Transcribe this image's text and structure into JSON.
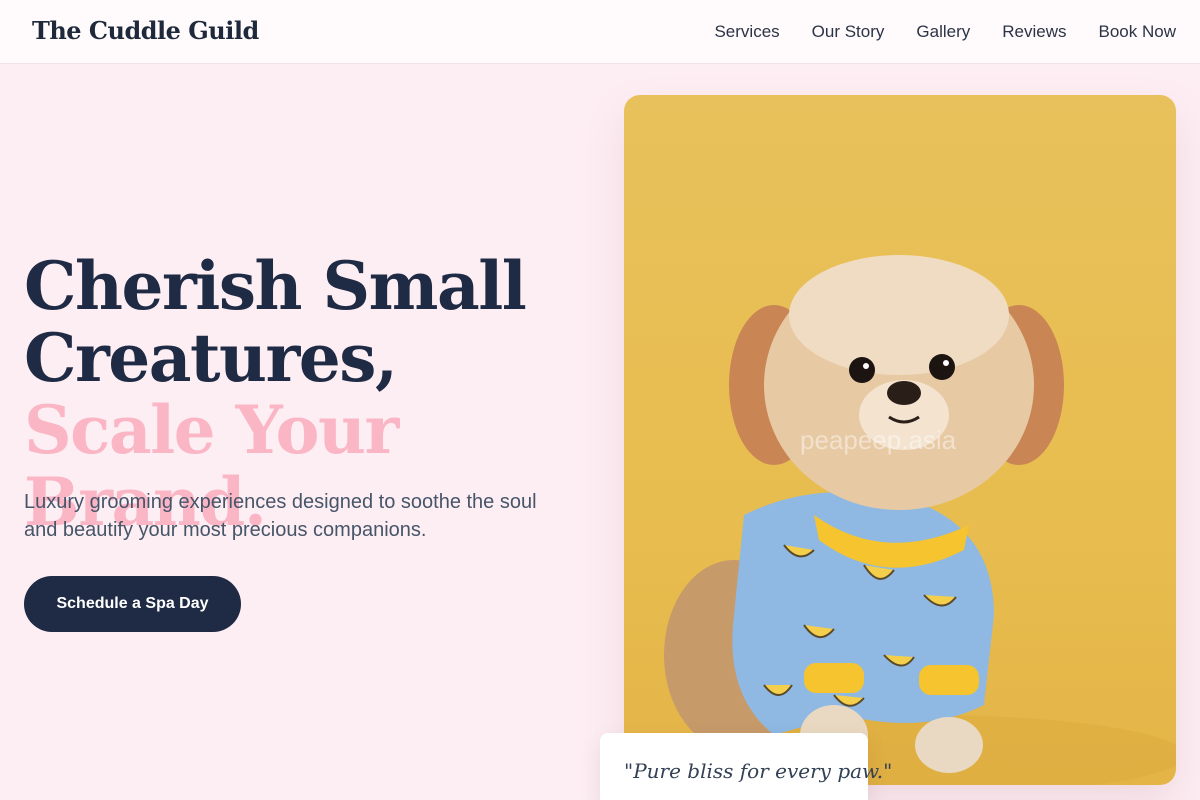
{
  "brand": {
    "name": "The Cuddle Guild"
  },
  "nav": {
    "items": [
      "Services",
      "Our Story",
      "Gallery",
      "Reviews",
      "Book Now"
    ]
  },
  "hero": {
    "headline_line1": "Cherish Small",
    "headline_line2": "Creatures, ",
    "headline_accent": "Scale Your Brand.",
    "subtext": "Luxury grooming experiences designed to soothe the soul and beautify your most precious companions.",
    "cta_label": "Schedule a Spa Day"
  },
  "photo": {
    "watermark": "peapeep.asia",
    "alt": "Small fluffy dog wearing banana-print pajamas on a yellow background"
  },
  "quote": {
    "text": "\"Pure bliss for every paw.\""
  },
  "colors": {
    "background": "#fdeef3",
    "navy": "#1f2a44",
    "accent_pink": "#fbb6c6",
    "photo_yellow": "#e8c15c"
  }
}
